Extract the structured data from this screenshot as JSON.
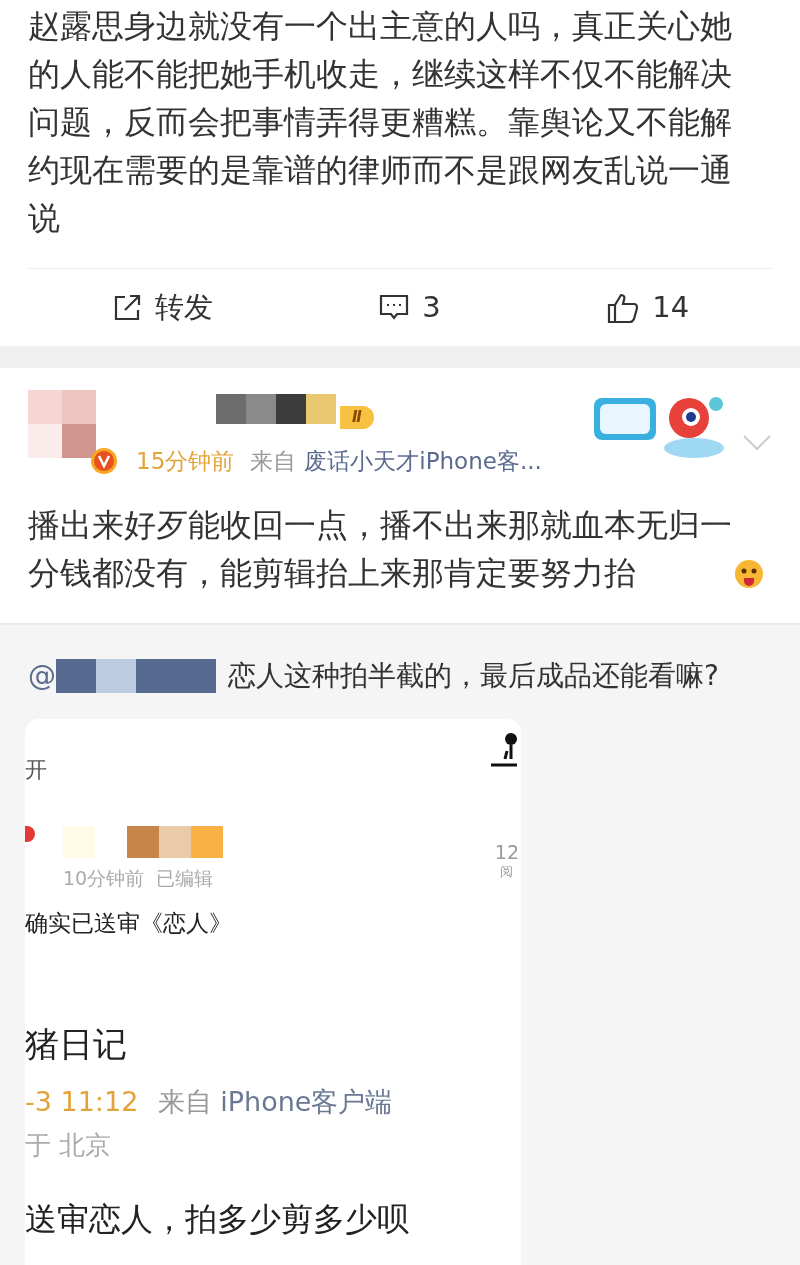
{
  "post": {
    "lines": [
      "赵露思身边就没有一个出主意的人吗，真正关心她",
      "的人能不能把她手机收走，继续这样不仅不能解决",
      "问题，反而会把事情弄得更糟糕。靠舆论又不能解",
      "约现在需要的是靠谱的律师而不是跟网友乱说一通",
      "说"
    ]
  },
  "actions": [
    {
      "kind": "repost",
      "label": "转发"
    },
    {
      "kind": "comment",
      "label": "3"
    },
    {
      "kind": "like",
      "label": "14"
    }
  ],
  "comment": {
    "level_badge": "Ⅱ",
    "time": "15分钟前",
    "from": "来自",
    "source": "废话小天才iPhone客...",
    "lines": [
      "播出来好歹能收回一点，播不出来那就血本无归一",
      "分钱都没有，能剪辑抬上来那肯定要努力抬"
    ]
  },
  "quote": {
    "mention": "@",
    "text": "恋人这种拍半截的，最后成品还能看嘛?"
  },
  "card": {
    "top_left": "开",
    "reads": "12",
    "reads_label": "阅",
    "meta": "10分钟前",
    "edited": "已编辑",
    "text": "确实已送审《恋人》",
    "author": "猪日记",
    "date": "-3 11:12",
    "from": "来自",
    "source": "iPhone客户端",
    "location": "于 北京",
    "body": "送审恋人，拍多少剪多少呗"
  }
}
